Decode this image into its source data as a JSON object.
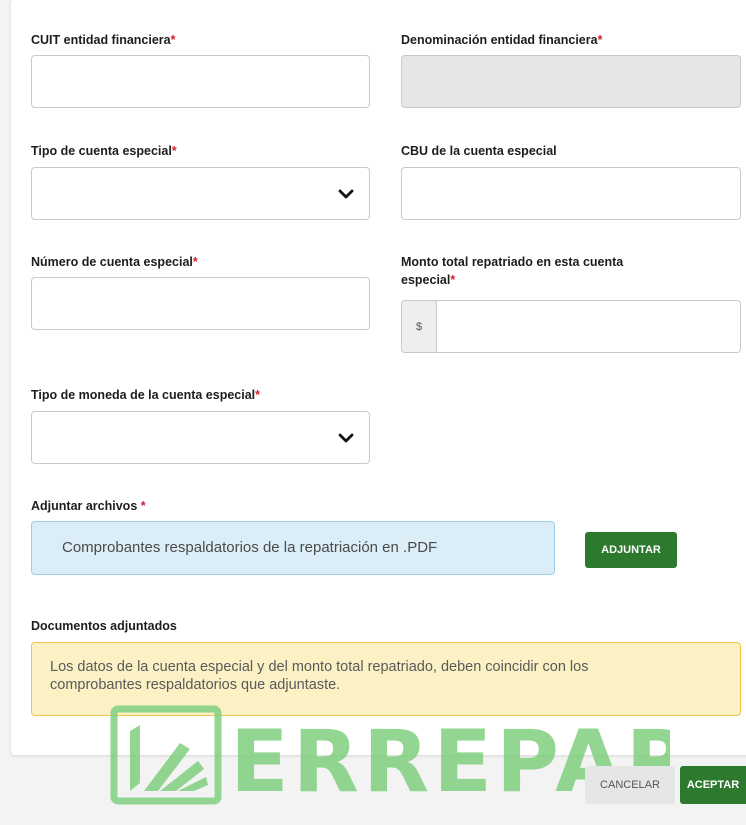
{
  "form": {
    "cuit": {
      "label": "CUIT entidad financiera",
      "value": ""
    },
    "denominacion": {
      "label": "Denominación entidad financiera",
      "value": ""
    },
    "tipo_cuenta": {
      "label": "Tipo de cuenta especial",
      "value": ""
    },
    "cbu": {
      "label": "CBU de la cuenta especial",
      "value": ""
    },
    "numero_cuenta": {
      "label": "Número de cuenta especial",
      "value": ""
    },
    "monto": {
      "label_line1": "Monto total repatriado en esta cuenta",
      "label_line2": "especial",
      "prefix": "$",
      "value": ""
    },
    "moneda": {
      "label": "Tipo de moneda de la cuenta especial",
      "value": ""
    },
    "required_mark": "*"
  },
  "attachments": {
    "label": "Adjuntar archivos",
    "hint": "Comprobantes respaldatorios de la repatriación en .PDF",
    "button": "ADJUNTAR",
    "documents_label": "Documentos adjuntados"
  },
  "alert": {
    "line1": "Los datos de la cuenta especial y del monto total repatriado, deben coincidir con los",
    "line2": "comprobantes respaldatorios que adjuntaste."
  },
  "footer": {
    "cancel": "CANCELAR",
    "accept": "ACEPTAR"
  },
  "watermark": {
    "text": "ERREPAR"
  },
  "colors": {
    "primary_green": "#2d7a2e",
    "required_red": "#d21f2d",
    "info_blue_bg": "#dbeef8",
    "warning_bg": "#fcf1c5",
    "watermark_green": "#7fcf7f"
  },
  "icons": {
    "select_chevron": "chevron-down-icon",
    "logo": "errepar-logo-icon"
  }
}
